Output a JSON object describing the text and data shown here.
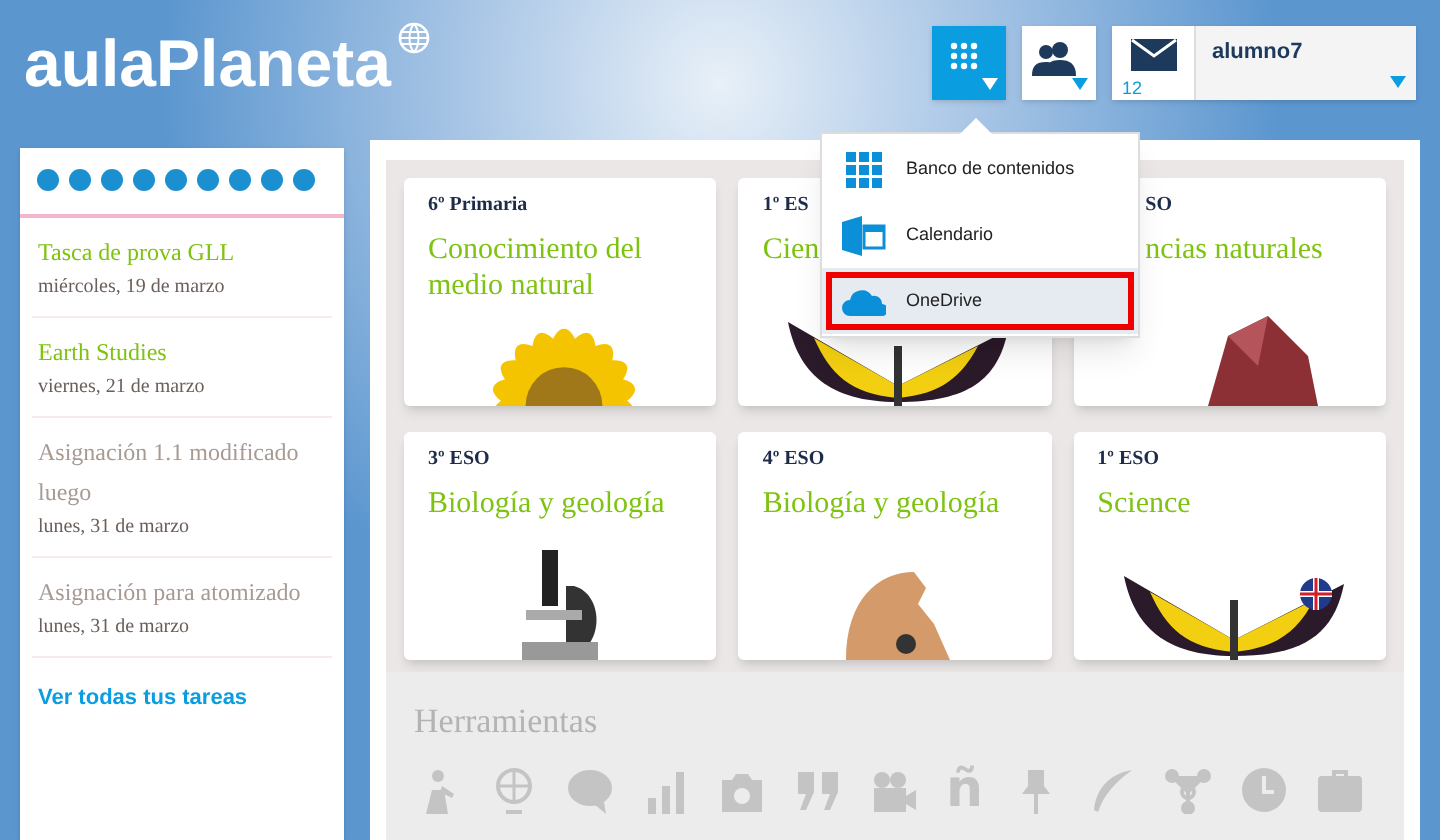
{
  "header": {
    "logo": "aulaPlaneta",
    "mail_count": "12",
    "username": "alumno7"
  },
  "tasks": [
    {
      "title": "Tasca de prova GLL",
      "date": "miércoles, 19 de marzo",
      "active": true
    },
    {
      "title": "Earth Studies",
      "date": "viernes, 21 de marzo",
      "active": true
    },
    {
      "title": "Asignación 1.1 modificado luego",
      "date": "lunes, 31 de marzo",
      "active": false
    },
    {
      "title": "Asignación para atomizado",
      "date": "lunes, 31 de marzo",
      "active": false
    }
  ],
  "tasks_link": "Ver todas tus tareas",
  "courses": [
    {
      "level": "6º Primaria",
      "title": "Conocimiento del medio natural",
      "kind": "sunflower"
    },
    {
      "level": "1º ES",
      "title": "Cien",
      "kind": "butterfly"
    },
    {
      "level": "SO",
      "title": "ncias naturales",
      "kind": "crystal"
    },
    {
      "level": "3º ESO",
      "title": "Biología y geología",
      "kind": "microscope"
    },
    {
      "level": "4º ESO",
      "title": "Biología y geología",
      "kind": "fossil"
    },
    {
      "level": "1º ESO",
      "title": "Science",
      "kind": "butterfly-flag"
    }
  ],
  "tools_title": "Herramientas",
  "tools": [
    {
      "kind": "scientist"
    },
    {
      "kind": "globe"
    },
    {
      "kind": "chat"
    },
    {
      "kind": "bars"
    },
    {
      "kind": "camera"
    },
    {
      "kind": "quote"
    },
    {
      "kind": "video"
    },
    {
      "kind": "letter",
      "text": "ñ"
    },
    {
      "kind": "pin"
    },
    {
      "kind": "feather"
    },
    {
      "kind": "nodes"
    },
    {
      "kind": "clock"
    },
    {
      "kind": "briefcase"
    }
  ],
  "apps_menu": [
    {
      "label": "Banco de contenidos",
      "kind": "grid",
      "selected": false
    },
    {
      "label": "Calendario",
      "kind": "calendar",
      "selected": false
    },
    {
      "label": "OneDrive",
      "kind": "cloud",
      "selected": true
    }
  ]
}
